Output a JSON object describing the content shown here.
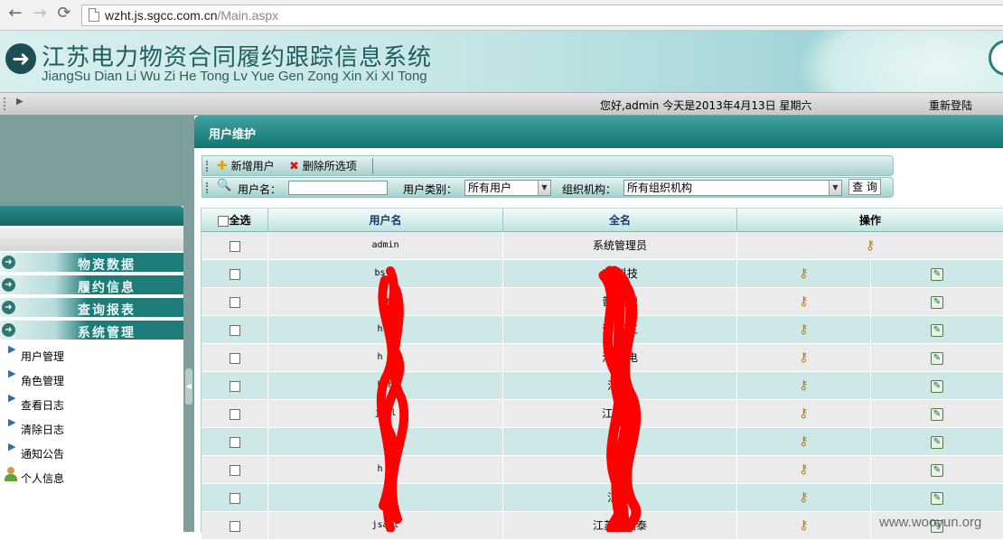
{
  "browser": {
    "back": "←",
    "forward": "→",
    "reload": "⟳",
    "url_host": "wzht.js.sgcc.com.cn",
    "url_path": "/Main.aspx"
  },
  "banner": {
    "title": "江苏电力物资合同履约跟踪信息系统",
    "subtitle": "JiangSu Dian Li Wu Zi He Tong Lv Yue Gen Zong Xin Xi XI Tong",
    "arrow": "➜"
  },
  "info_bar": {
    "greeting": "您好,admin 今天是2013年4月13日 星期六",
    "relogin": "重新登陆"
  },
  "sidebar": {
    "menu": [
      {
        "label": "物资数据"
      },
      {
        "label": "履约信息"
      },
      {
        "label": "查询报表"
      },
      {
        "label": "系统管理"
      }
    ],
    "sub_items": [
      {
        "label": "用户管理"
      },
      {
        "label": "角色管理"
      },
      {
        "label": "查看日志"
      },
      {
        "label": "清除日志"
      },
      {
        "label": "通知公告"
      },
      {
        "label": "个人信息"
      }
    ]
  },
  "main": {
    "title": "用户维护",
    "toolbar": {
      "add_user": "新增用户",
      "delete_selected": "删除所选项"
    },
    "search": {
      "username_label": "用户名：",
      "username_value": "",
      "user_type_label": "用户类别：",
      "user_type_value": "所有用户",
      "org_label": "组织机构：",
      "org_value": "所有组织机构",
      "query_button": "查 询"
    },
    "grid": {
      "select_all": "全选",
      "headers": [
        "用户名",
        "全名",
        "操作"
      ],
      "rows": [
        {
          "username": "admin",
          "fullname": "系统管理员"
        },
        {
          "username": "bs j",
          "fullname": "宝   科技"
        },
        {
          "username": "pr",
          "fullname": "普   同德"
        },
        {
          "username": "h  g",
          "fullname": "江   长江"
        },
        {
          "username": "h  n",
          "fullname": "江南   电"
        },
        {
          "username": "h  h",
          "fullname": "江   上"
        },
        {
          "username": "js  l",
          "fullname": "江苏   力"
        },
        {
          "username": "   i",
          "fullname": "东   能"
        },
        {
          "username": "h   t",
          "fullname": "华   吉"
        },
        {
          "username": "js",
          "fullname": "江   鹏"
        },
        {
          "username": "jsart",
          "fullname": "江苏华瑞泰"
        }
      ]
    }
  },
  "watermark": "www.wooyun.org",
  "colors": {
    "teal_dark": "#137572",
    "teal_light": "#cde8e6",
    "scribble": "#ff0000"
  }
}
